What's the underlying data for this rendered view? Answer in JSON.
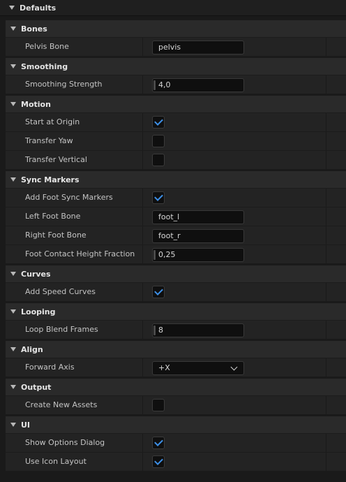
{
  "header": {
    "title": "Defaults"
  },
  "sections": {
    "bones": {
      "title": "Bones",
      "pelvis_bone": {
        "label": "Pelvis Bone",
        "value": "pelvis"
      }
    },
    "smoothing": {
      "title": "Smoothing",
      "smoothing_strength": {
        "label": "Smoothing Strength",
        "value": "4,0"
      }
    },
    "motion": {
      "title": "Motion",
      "start_at_origin": {
        "label": "Start at Origin",
        "checked": true
      },
      "transfer_yaw": {
        "label": "Transfer Yaw",
        "checked": false
      },
      "transfer_vertical": {
        "label": "Transfer Vertical",
        "checked": false
      }
    },
    "sync_markers": {
      "title": "Sync Markers",
      "add_foot_sync_markers": {
        "label": "Add Foot Sync Markers",
        "checked": true
      },
      "left_foot_bone": {
        "label": "Left Foot Bone",
        "value": "foot_l"
      },
      "right_foot_bone": {
        "label": "Right Foot Bone",
        "value": "foot_r"
      },
      "foot_contact_height_fraction": {
        "label": "Foot Contact Height Fraction",
        "value": "0,25"
      }
    },
    "curves": {
      "title": "Curves",
      "add_speed_curves": {
        "label": "Add Speed Curves",
        "checked": true
      }
    },
    "looping": {
      "title": "Looping",
      "loop_blend_frames": {
        "label": "Loop Blend Frames",
        "value": "8"
      }
    },
    "align": {
      "title": "Align",
      "forward_axis": {
        "label": "Forward Axis",
        "value": "+X"
      }
    },
    "output": {
      "title": "Output",
      "create_new_assets": {
        "label": "Create New Assets",
        "checked": false
      }
    },
    "ui": {
      "title": "UI",
      "show_options_dialog": {
        "label": "Show Options Dialog",
        "checked": true
      },
      "use_icon_layout": {
        "label": "Use Icon Layout",
        "checked": true
      }
    }
  },
  "colors": {
    "accent": "#3d8fe6",
    "panel": "#232323",
    "header": "#2a2a2a"
  }
}
